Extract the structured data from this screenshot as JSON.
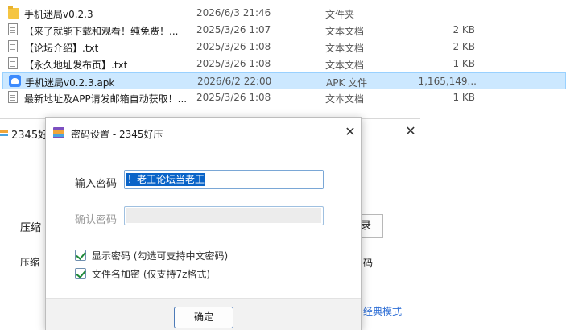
{
  "files": [
    {
      "icon": "folder-icon",
      "name": "手机迷局v0.2.3",
      "date": "2026/6/3 21:46",
      "type": "文件夹",
      "size": ""
    },
    {
      "icon": "text-file-icon",
      "name": "【来了就能下载和观看！纯免费！...",
      "date": "2025/3/26 1:07",
      "type": "文本文档",
      "size": "2 KB"
    },
    {
      "icon": "text-file-icon",
      "name": "【论坛介绍】.txt",
      "date": "2025/3/26 1:08",
      "type": "文本文档",
      "size": "2 KB"
    },
    {
      "icon": "text-file-icon",
      "name": "【永久地址发布页】.txt",
      "date": "2025/3/26 1:08",
      "type": "文本文档",
      "size": "1 KB"
    },
    {
      "icon": "apk-icon",
      "name": "手机迷局v0.2.3.apk",
      "date": "2026/6/2 22:00",
      "type": "APK 文件",
      "size": "1,165,149...",
      "selected": true
    },
    {
      "icon": "text-file-icon",
      "name": "最新地址及APP请发邮箱自动获取！...",
      "date": "2025/3/26 1:08",
      "type": "文本文档",
      "size": "1 KB"
    }
  ],
  "background_window": {
    "title": "2345好",
    "close": "✕",
    "label1": "压缩",
    "label2": "压缩",
    "button_partial": "录",
    "text_partial": "码",
    "link_partial": "经典模式"
  },
  "dialog": {
    "title": "密码设置 - 2345好压",
    "close": "✕",
    "password_label": "输入密码",
    "password_value": "！老王论坛当老王",
    "confirm_label": "确认密码",
    "show_password_label": "显示密码 (勾选可支持中文密码)",
    "show_password_checked": true,
    "encrypt_names_label": "文件名加密 (仅支持7z格式)",
    "encrypt_names_checked": true,
    "ok_label": "确定"
  }
}
